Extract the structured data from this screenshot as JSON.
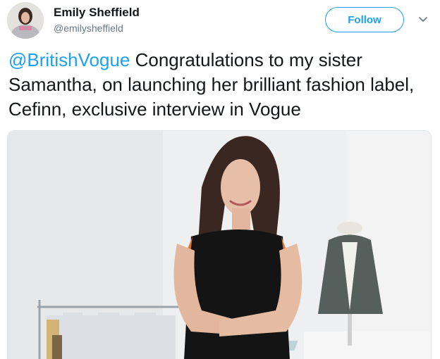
{
  "tweet": {
    "author": {
      "display_name": "Emily Sheffield",
      "handle": "@emilysheffield"
    },
    "follow_label": "Follow",
    "mention": "@BritishVogue",
    "text": " Congratulations to my sister Samantha, on launching her brilliant fashion label, Cefinn, exclusive interview in Vogue",
    "media": {
      "description_icon": "photo"
    }
  },
  "colors": {
    "accent": "#1da1f2",
    "text": "#14171a",
    "secondary_text": "#657786"
  }
}
